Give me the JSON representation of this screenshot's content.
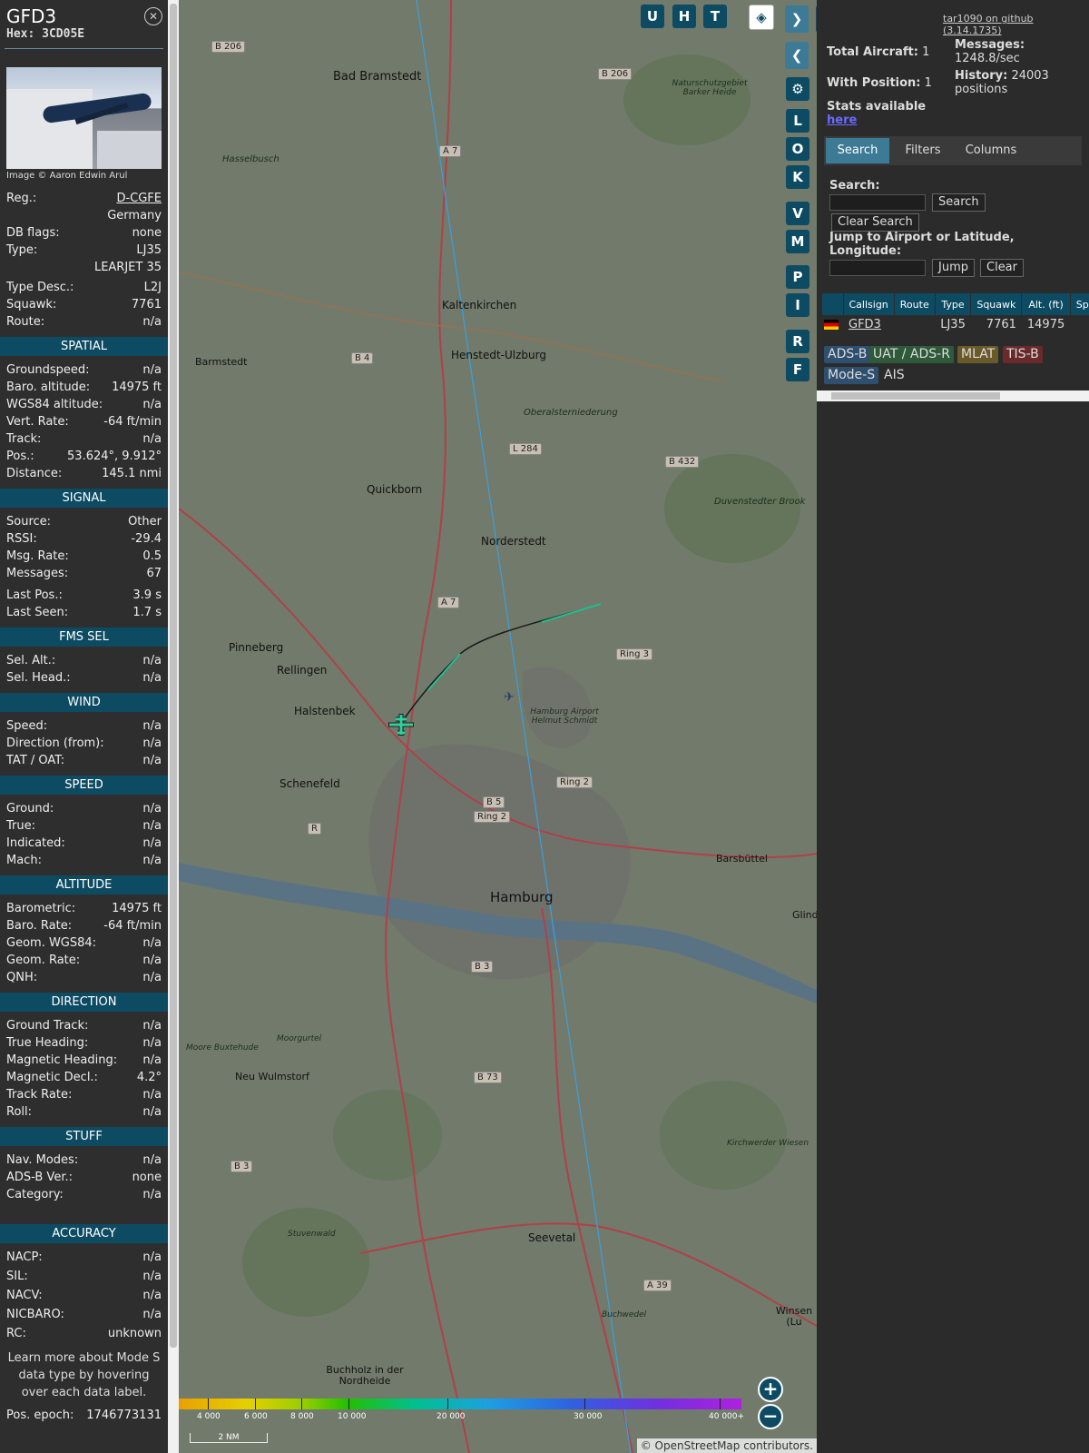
{
  "aircraft": {
    "callsign": "GFD3",
    "hex_label": "Hex: 3CD05E",
    "image_credit": "Image © Aaron Edwin Arul",
    "fields": [
      {
        "label": "Reg.:",
        "value": "D-CGFE"
      },
      {
        "label": "",
        "value": "Germany"
      },
      {
        "label": "DB flags:",
        "value": "none"
      },
      {
        "label": "Type:",
        "value": "LJ35"
      },
      {
        "label": "",
        "value": "LEARJET 35"
      },
      {
        "label": "Type Desc.:",
        "value": "L2J"
      },
      {
        "label": "Squawk:",
        "value": "7761"
      },
      {
        "label": "Route:",
        "value": "n/a"
      }
    ]
  },
  "sections": {
    "spatial": {
      "title": "SPATIAL",
      "rows": [
        {
          "label": "Groundspeed:",
          "value": "n/a"
        },
        {
          "label": "Baro. altitude:",
          "value": "14975 ft"
        },
        {
          "label": "WGS84 altitude:",
          "value": "n/a"
        },
        {
          "label": "Vert. Rate:",
          "value": "-64 ft/min"
        },
        {
          "label": "Track:",
          "value": "n/a"
        },
        {
          "label": "Pos.:",
          "value": "53.624°, 9.912°"
        },
        {
          "label": "Distance:",
          "value": "145.1 nmi"
        }
      ]
    },
    "signal": {
      "title": "SIGNAL",
      "rows": [
        {
          "label": "Source:",
          "value": "Other"
        },
        {
          "label": "RSSI:",
          "value": "-29.4"
        },
        {
          "label": "Msg. Rate:",
          "value": "0.5"
        },
        {
          "label": "Messages:",
          "value": "67"
        },
        {
          "label": "Last Pos.:",
          "value": "3.9 s"
        },
        {
          "label": "Last Seen:",
          "value": "1.7 s"
        }
      ]
    },
    "fms": {
      "title": "FMS SEL",
      "rows": [
        {
          "label": "Sel. Alt.:",
          "value": "n/a"
        },
        {
          "label": "Sel. Head.:",
          "value": "n/a"
        }
      ]
    },
    "wind": {
      "title": "WIND",
      "rows": [
        {
          "label": "Speed:",
          "value": "n/a"
        },
        {
          "label": "Direction (from):",
          "value": "n/a"
        },
        {
          "label": "TAT / OAT:",
          "value": "n/a"
        }
      ]
    },
    "speed": {
      "title": "SPEED",
      "rows": [
        {
          "label": "Ground:",
          "value": "n/a"
        },
        {
          "label": "True:",
          "value": "n/a"
        },
        {
          "label": "Indicated:",
          "value": "n/a"
        },
        {
          "label": "Mach:",
          "value": "n/a"
        }
      ]
    },
    "altitude": {
      "title": "ALTITUDE",
      "rows": [
        {
          "label": "Barometric:",
          "value": "14975 ft"
        },
        {
          "label": "Baro. Rate:",
          "value": "-64 ft/min"
        },
        {
          "label": "Geom. WGS84:",
          "value": "n/a"
        },
        {
          "label": "Geom. Rate:",
          "value": "n/a"
        },
        {
          "label": "QNH:",
          "value": "n/a"
        }
      ]
    },
    "direction": {
      "title": "DIRECTION",
      "rows": [
        {
          "label": "Ground Track:",
          "value": "n/a"
        },
        {
          "label": "True Heading:",
          "value": "n/a"
        },
        {
          "label": "Magnetic Heading:",
          "value": "n/a"
        },
        {
          "label": "Magnetic Decl.:",
          "value": "4.2°"
        },
        {
          "label": "Track Rate:",
          "value": "n/a"
        },
        {
          "label": "Roll:",
          "value": "n/a"
        }
      ]
    },
    "stuff": {
      "title": "STUFF",
      "rows": [
        {
          "label": "Nav. Modes:",
          "value": "n/a"
        },
        {
          "label": "ADS-B Ver.:",
          "value": "none"
        },
        {
          "label": "Category:",
          "value": "n/a"
        }
      ]
    },
    "accuracy": {
      "title": "ACCURACY",
      "rows": [
        {
          "label": "NACP:",
          "value": "n/a"
        },
        {
          "label": "SIL:",
          "value": "n/a"
        },
        {
          "label": "NACV:",
          "value": "n/a"
        },
        {
          "label": "NICBARO:",
          "value": "n/a"
        },
        {
          "label": "RC:",
          "value": "unknown"
        }
      ]
    }
  },
  "info_note": "Learn more about Mode S data type by hovering over each data label.",
  "pos_epoch": {
    "label": "Pos. epoch:",
    "value": "1746773131"
  },
  "map": {
    "buttons": [
      "U",
      "H",
      "T"
    ],
    "side_buttons": [
      "L",
      "O",
      "K",
      "V",
      "M",
      "P",
      "I",
      "R",
      "F"
    ],
    "colorbar_labels": [
      "4 000",
      "6 000",
      "8 000",
      "10 000",
      "20 000",
      "30 000",
      "40 000+"
    ],
    "scale": "2 NM",
    "attribution": "© OpenStreetMap contributors.",
    "places": [
      "Bad Bramstedt",
      "Hasselbusch",
      "Kaltenkirchen",
      "Henstedt-Ulzburg",
      "Barmstedt",
      "Quickborn",
      "Norderstedt",
      "Pinneberg",
      "Rellingen",
      "Halstenbek",
      "Schenefeld",
      "Hamburg",
      "Neu Wulmstorf",
      "Seevetal",
      "Buchholz in der Nordheide",
      "Barsbüttel",
      "Duvenstedter Brook",
      "Naturschutzgebiet Barker Heide",
      "Oberalsterniederung",
      "Hamburg Airport Helmut Schmidt",
      "Moorgurtel",
      "Moore Buxtehude",
      "Stuvenwald",
      "Kirchwerder Wiesen",
      "Buchwedel",
      "Winsen (Lu",
      "Glind"
    ],
    "roads": [
      "B 206",
      "B 206",
      "A 7",
      "B 4",
      "L 284",
      "B 432",
      "A 7",
      "Ring 3",
      "Ring 2",
      "B 5",
      "Ring 2",
      "R",
      "B 3",
      "B 73",
      "B 3",
      "A 39"
    ]
  },
  "sidebar": {
    "github": "tar1090 on github (3.14.1735)",
    "total_aircraft_label": "Total Aircraft:",
    "total_aircraft": "1",
    "with_position_label": "With Position:",
    "with_position": "1",
    "stats_label": "Stats available",
    "stats_link": "here",
    "messages_label": "Messages:",
    "messages": "1248.8/sec",
    "history_label": "History:",
    "history": "24003",
    "history_unit": "positions",
    "tabs": [
      "Search",
      "Filters",
      "Columns"
    ],
    "search_label": "Search:",
    "search_btn": "Search",
    "clear_search_btn": "Clear Search",
    "jump_label": "Jump to Airport or Latitude, Longitude:",
    "jump_btn": "Jump",
    "clear_btn": "Clear",
    "columns": [
      "Callsign",
      "Route",
      "Type",
      "Squawk",
      "Alt. (ft)",
      "Spd."
    ],
    "row": {
      "callsign": "GFD3",
      "route": "",
      "type": "LJ35",
      "squawk": "7761",
      "alt": "14975",
      "spd": ""
    },
    "legend": [
      {
        "label": "ADS-B",
        "color": "#2f4f6f"
      },
      {
        "label": "UAT / ADS-R",
        "color": "#2f5a3a"
      },
      {
        "label": "MLAT",
        "color": "#6a5a2a"
      },
      {
        "label": "TIS-B",
        "color": "#6a2a2a"
      },
      {
        "label": "Mode-S",
        "color": "#2f4f6f"
      },
      {
        "label": "AIS",
        "color": ""
      }
    ]
  }
}
